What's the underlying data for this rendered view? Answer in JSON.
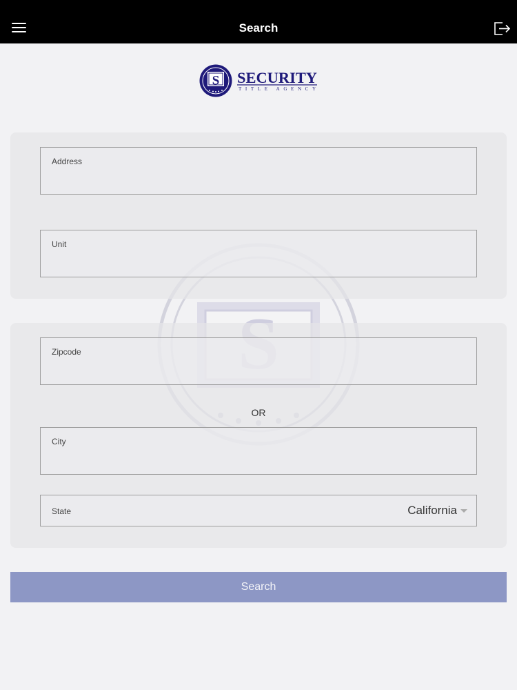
{
  "header": {
    "title": "Search",
    "menu_icon": "hamburger-menu-icon",
    "logout_icon": "logout-icon"
  },
  "logo": {
    "letter": "S",
    "name": "SECURITY",
    "tagline": "TITLE AGENCY",
    "color": "#1f1a7a"
  },
  "form": {
    "address_label": "Address",
    "unit_label": "Unit",
    "zipcode_label": "Zipcode",
    "or_text": "OR",
    "city_label": "City",
    "state_label": "State",
    "state_value": "California"
  },
  "search_button": {
    "label": "Search",
    "color": "#8d97c5"
  }
}
